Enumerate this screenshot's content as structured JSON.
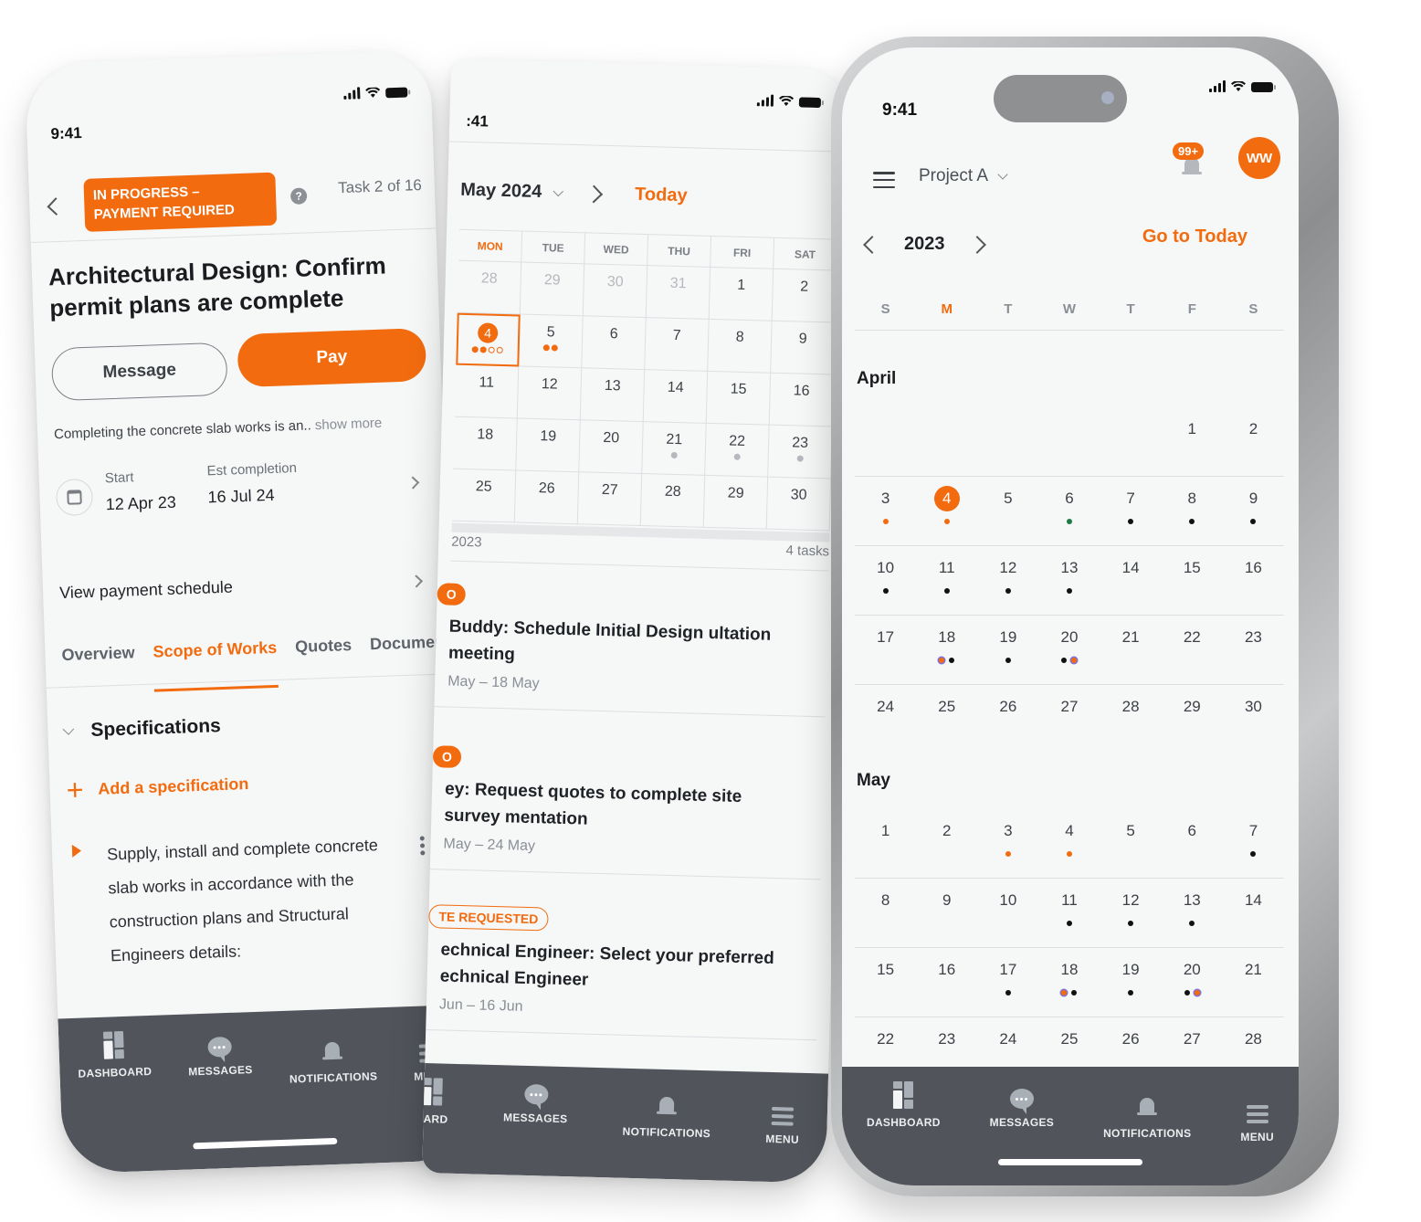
{
  "status_bar": {
    "time": "9:41",
    "time_partial": ":41"
  },
  "tabbar": {
    "items": [
      {
        "label": "DASHBOARD",
        "icon": "dashboard-icon"
      },
      {
        "label": "MESSAGES",
        "icon": "messages-icon"
      },
      {
        "label": "NOTIFICATIONS",
        "icon": "bell-icon"
      },
      {
        "label": "MENU",
        "icon": "menu-icon"
      }
    ],
    "partial_dashboard_label": "OARD"
  },
  "task_screen": {
    "status_badge": "IN PROGRESS – PAYMENT REQUIRED",
    "help": "?",
    "task_counter": "Task 2 of 16",
    "title": "Architectural Design: Confirm permit plans are complete",
    "message_button": "Message",
    "pay_button": "Pay",
    "description": "Completing the concrete slab works is an..",
    "show_more": "show more",
    "start_label": "Start",
    "start_value": "12 Apr 23",
    "completion_label": "Est completion",
    "completion_value": "16 Jul 24",
    "payment_schedule": "View payment schedule",
    "tabs": [
      {
        "label": "Overview",
        "active": false
      },
      {
        "label": "Scope of Works",
        "active": true
      },
      {
        "label": "Quotes",
        "active": false
      },
      {
        "label": "Documents",
        "active": false
      }
    ],
    "section_title": "Specifications",
    "add_specification": "Add a specification",
    "spec_item": "Supply, install and complete concrete slab works in accordance with the construction plans and Structural Engineers details:"
  },
  "month_screen": {
    "month_label": "May 2024",
    "today_button": "Today",
    "weekdays": [
      "MON",
      "TUE",
      "WED",
      "THU",
      "FRI",
      "SAT"
    ],
    "highlight_weekday": "MON",
    "weeks": [
      [
        {
          "d": "28",
          "dim": true
        },
        {
          "d": "29",
          "dim": true
        },
        {
          "d": "30",
          "dim": true
        },
        {
          "d": "31",
          "dim": true
        },
        {
          "d": "1"
        },
        {
          "d": "2"
        }
      ],
      [
        {
          "d": "4",
          "selected": true,
          "dots": [
            "o",
            "o",
            "oo",
            "oo"
          ]
        },
        {
          "d": "5",
          "dots": [
            "o",
            "o"
          ]
        },
        {
          "d": "6"
        },
        {
          "d": "7"
        },
        {
          "d": "8"
        },
        {
          "d": "9"
        }
      ],
      [
        {
          "d": "11"
        },
        {
          "d": "12"
        },
        {
          "d": "13"
        },
        {
          "d": "14"
        },
        {
          "d": "15"
        },
        {
          "d": "16"
        }
      ],
      [
        {
          "d": "18"
        },
        {
          "d": "19"
        },
        {
          "d": "20"
        },
        {
          "d": "21",
          "dots": [
            "g"
          ]
        },
        {
          "d": "22",
          "dots": [
            "g"
          ]
        },
        {
          "d": "23",
          "dots": [
            "g"
          ]
        }
      ],
      [
        {
          "d": "25"
        },
        {
          "d": "26"
        },
        {
          "d": "27"
        },
        {
          "d": "28"
        },
        {
          "d": "29"
        },
        {
          "d": "30"
        }
      ]
    ],
    "list_date": "2023",
    "list_count": "4 tasks",
    "tasks": [
      {
        "chip": "O",
        "title": "Buddy: Schedule Initial Design ultation meeting",
        "range": "May – 18 May"
      },
      {
        "chip": "O",
        "title": "ey: Request quotes to complete site survey mentation",
        "range": "May – 24 May"
      },
      {
        "chip": "TE REQUESTED",
        "title": "echnical Engineer: Select your preferred echnical Engineer",
        "range": "Jun – 16 Jun"
      }
    ]
  },
  "year_screen": {
    "project": "Project A",
    "notification_badge": "99+",
    "avatar_initials": "WW",
    "year": "2023",
    "go_to_today": "Go to Today",
    "weekdays": [
      "S",
      "M",
      "T",
      "W",
      "T",
      "F",
      "S"
    ],
    "highlight_weekday_index": 1,
    "months": [
      {
        "name": "April",
        "weeks": [
          [
            {
              "d": ""
            },
            {
              "d": ""
            },
            {
              "d": ""
            },
            {
              "d": ""
            },
            {
              "d": ""
            },
            {
              "d": "1"
            },
            {
              "d": "2"
            }
          ],
          [
            {
              "d": "3",
              "dots": [
                "orange"
              ]
            },
            {
              "d": "4",
              "today": true,
              "dots": [
                "orange"
              ]
            },
            {
              "d": "5"
            },
            {
              "d": "6",
              "dots": [
                "green"
              ]
            },
            {
              "d": "7",
              "dots": [
                "black"
              ]
            },
            {
              "d": "8",
              "dots": [
                "black"
              ]
            },
            {
              "d": "9",
              "dots": [
                "black"
              ]
            }
          ],
          [
            {
              "d": "10",
              "dots": [
                "black"
              ]
            },
            {
              "d": "11",
              "dots": [
                "black"
              ]
            },
            {
              "d": "12",
              "dots": [
                "black"
              ]
            },
            {
              "d": "13",
              "dots": [
                "black"
              ]
            },
            {
              "d": "14"
            },
            {
              "d": "15"
            },
            {
              "d": "16"
            }
          ],
          [
            {
              "d": "17"
            },
            {
              "d": "18",
              "dots": [
                "mixed",
                "black"
              ]
            },
            {
              "d": "19",
              "dots": [
                "black"
              ]
            },
            {
              "d": "20",
              "dots": [
                "black",
                "mixed"
              ]
            },
            {
              "d": "21"
            },
            {
              "d": "22"
            },
            {
              "d": "23"
            }
          ],
          [
            {
              "d": "24"
            },
            {
              "d": "25"
            },
            {
              "d": "26"
            },
            {
              "d": "27"
            },
            {
              "d": "28"
            },
            {
              "d": "29"
            },
            {
              "d": "30"
            }
          ]
        ]
      },
      {
        "name": "May",
        "weeks": [
          [
            {
              "d": "1"
            },
            {
              "d": "2"
            },
            {
              "d": "3",
              "dots": [
                "orange"
              ]
            },
            {
              "d": "4",
              "dots": [
                "orange"
              ]
            },
            {
              "d": "5"
            },
            {
              "d": "6"
            },
            {
              "d": "7",
              "dots": [
                "black"
              ]
            }
          ],
          [
            {
              "d": "8"
            },
            {
              "d": "9"
            },
            {
              "d": "10"
            },
            {
              "d": "11",
              "dots": [
                "black"
              ]
            },
            {
              "d": "12",
              "dots": [
                "black"
              ]
            },
            {
              "d": "13",
              "dots": [
                "black"
              ]
            },
            {
              "d": "14"
            }
          ],
          [
            {
              "d": "15"
            },
            {
              "d": "16"
            },
            {
              "d": "17",
              "dots": [
                "black"
              ]
            },
            {
              "d": "18",
              "dots": [
                "mixed",
                "black"
              ]
            },
            {
              "d": "19",
              "dots": [
                "black"
              ]
            },
            {
              "d": "20",
              "dots": [
                "black",
                "mixed"
              ]
            },
            {
              "d": "21"
            }
          ],
          [
            {
              "d": "22"
            },
            {
              "d": "23"
            },
            {
              "d": "24"
            },
            {
              "d": "25"
            },
            {
              "d": "26"
            },
            {
              "d": "27"
            },
            {
              "d": "28"
            }
          ]
        ]
      }
    ]
  },
  "colors": {
    "accent": "#f26b0f",
    "tabbar": "#51555b",
    "background": "#f6f7f7"
  }
}
